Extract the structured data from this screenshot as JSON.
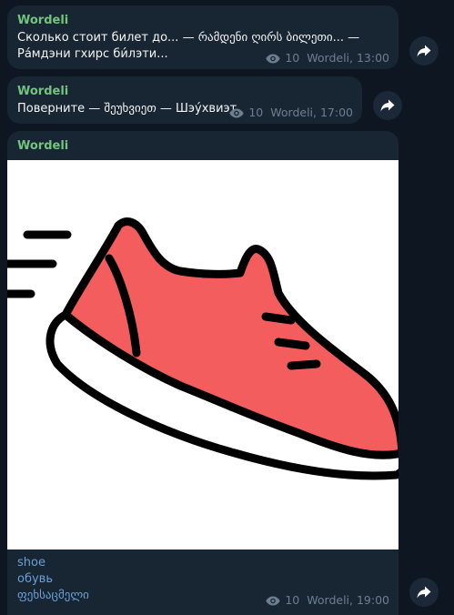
{
  "colors": {
    "background": "#0e1621",
    "bubble": "#182533",
    "sender": "#73c47f",
    "message_text": "#f5f5f5",
    "meta": "#6d7f8f",
    "caption_text": "#6aa1d5",
    "shoe_red": "#f45d5d"
  },
  "messages": [
    {
      "sender": "Wordeli",
      "text_line1": "Сколько стоит билет до... — რამდენი ღირს ბილეთი... —",
      "text_line2": "Ра́мдэни гхирс би́лэти...",
      "views": "10",
      "signature": "Wordeli, 13:00",
      "icons": [
        "eye-icon",
        "forward-icon"
      ]
    },
    {
      "sender": "Wordeli",
      "text_line1": "Поверните — შეუხვიეთ — Шэу́хвиэт",
      "views": "10",
      "signature": "Wordeli, 17:00",
      "icons": [
        "eye-icon",
        "forward-icon"
      ]
    },
    {
      "sender": "Wordeli",
      "image": "red-sneaker-illustration",
      "caption": [
        "shoe",
        "обувь",
        "ფეხსაცმელი"
      ],
      "views": "10",
      "signature": "Wordeli, 19:00",
      "icons": [
        "eye-icon",
        "forward-icon"
      ]
    }
  ]
}
